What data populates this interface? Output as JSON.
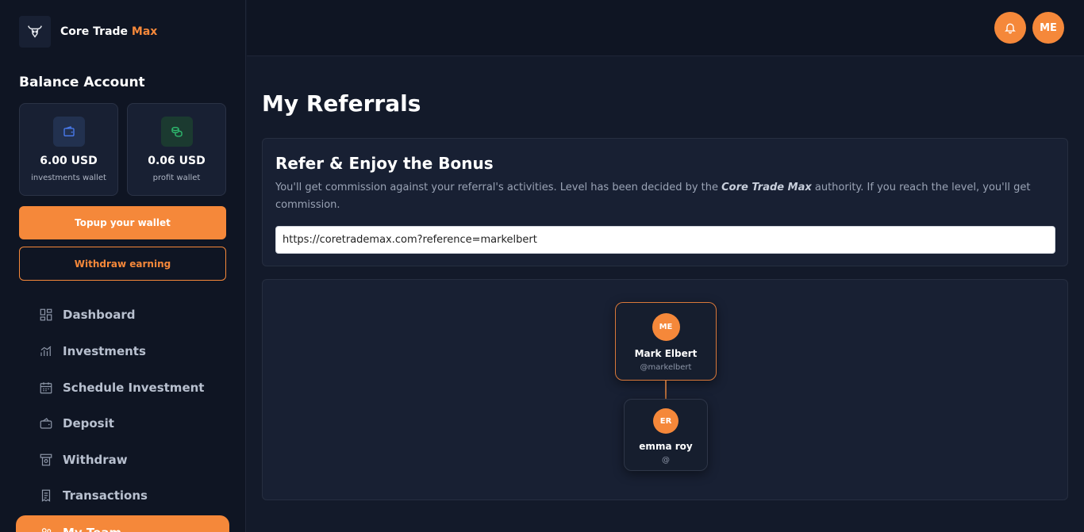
{
  "brand": {
    "name": "Core Trade",
    "accent": "Max"
  },
  "balance": {
    "title": "Balance Account",
    "wallets": [
      {
        "amount": "6.00 USD",
        "label": "investments wallet",
        "icon": "wallet-icon",
        "color": "#4a7cf0"
      },
      {
        "amount": "0.06 USD",
        "label": "profit wallet",
        "icon": "coins-icon",
        "color": "#2fbf71"
      }
    ]
  },
  "actions": {
    "topup": "Topup your wallet",
    "withdraw": "Withdraw earning"
  },
  "nav": {
    "items": [
      {
        "label": "Dashboard",
        "icon": "dashboard-icon"
      },
      {
        "label": "Investments",
        "icon": "chart-icon"
      },
      {
        "label": "Schedule Investment",
        "icon": "calendar-icon"
      },
      {
        "label": "Deposit",
        "icon": "deposit-icon"
      },
      {
        "label": "Withdraw",
        "icon": "atm-icon"
      },
      {
        "label": "Transactions",
        "icon": "receipt-icon"
      },
      {
        "label": "My Team",
        "icon": "team-icon",
        "active": true
      }
    ]
  },
  "topbar": {
    "notifications_icon": "bell-icon",
    "avatar_initials": "ME"
  },
  "page": {
    "title": "My Referrals"
  },
  "refer": {
    "title": "Refer & Enjoy the Bonus",
    "desc_before": "You'll get commission against your referral's activities. Level has been decided by the ",
    "desc_brand": "Core Trade Max",
    "desc_after": " authority. If you reach the level, you'll get commission.",
    "link": "https://coretrademax.com?reference=markelbert"
  },
  "tree": {
    "root": {
      "initials": "ME",
      "name": "Mark Elbert",
      "username": "@markelbert"
    },
    "children": [
      {
        "initials": "ER",
        "name": "emma roy",
        "username": "@"
      }
    ]
  },
  "colors": {
    "accent": "#f5883a",
    "background": "#131a2a",
    "card": "#182033"
  }
}
